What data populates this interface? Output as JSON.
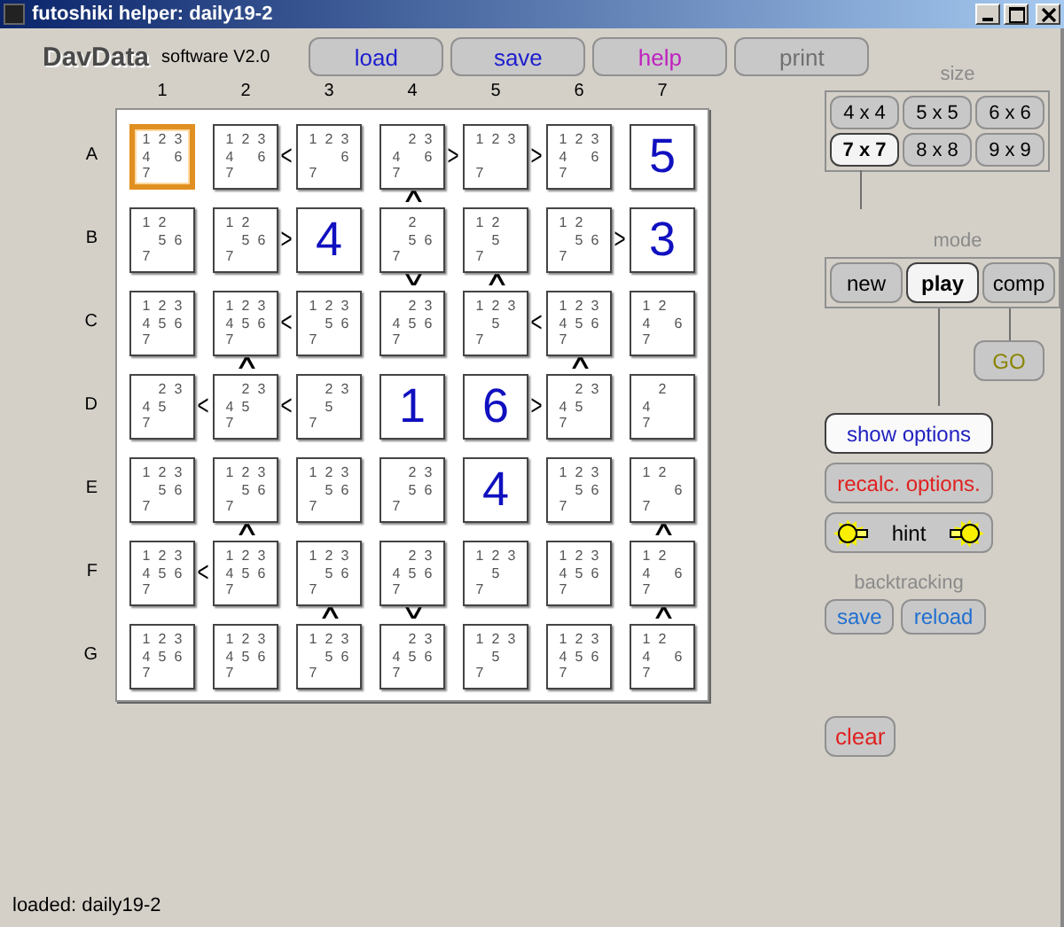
{
  "window": {
    "title": "futoshiki helper: daily19-2"
  },
  "logo": "DavData",
  "version": "software V2.0",
  "toolbar": [
    {
      "label": "load",
      "color": "#1c1cd0",
      "disabled": false
    },
    {
      "label": "save",
      "color": "#1c1cd0",
      "disabled": false
    },
    {
      "label": "help",
      "color": "#c020c0",
      "disabled": false
    },
    {
      "label": "print",
      "disabled": true
    }
  ],
  "board": {
    "column_labels": [
      "1",
      "2",
      "3",
      "4",
      "5",
      "6",
      "7"
    ],
    "row_labels": [
      "A",
      "B",
      "C",
      "D",
      "E",
      "F",
      "G"
    ],
    "rows": [
      [
        {
          "selected": true,
          "candidates": [
            "1",
            "2",
            "3",
            "4",
            "6",
            "7"
          ]
        },
        {
          "selected": false,
          "candidates": [
            "1",
            "2",
            "3",
            "4",
            "6",
            "7"
          ],
          "right": "<"
        },
        {
          "selected": false,
          "candidates": [
            "1",
            "2",
            "3",
            "6",
            "7"
          ]
        },
        {
          "selected": false,
          "candidates": [
            "2",
            "3",
            "4",
            "6",
            "7"
          ],
          "right": ">",
          "below": "∧"
        },
        {
          "selected": false,
          "candidates": [
            "1",
            "2",
            "3",
            "7"
          ],
          "right": ">"
        },
        {
          "selected": false,
          "candidates": [
            "1",
            "2",
            "3",
            "4",
            "6",
            "7"
          ]
        },
        {
          "selected": false,
          "value": "5"
        }
      ],
      [
        {
          "selected": false,
          "candidates": [
            "1",
            "2",
            "5",
            "6",
            "7"
          ]
        },
        {
          "selected": false,
          "candidates": [
            "1",
            "2",
            "5",
            "6",
            "7"
          ],
          "right": ">"
        },
        {
          "selected": false,
          "value": "4"
        },
        {
          "selected": false,
          "candidates": [
            "2",
            "5",
            "6",
            "7"
          ],
          "below": "∨"
        },
        {
          "selected": false,
          "candidates": [
            "1",
            "2",
            "5",
            "7"
          ],
          "below": "∧"
        },
        {
          "selected": false,
          "candidates": [
            "1",
            "2",
            "5",
            "6",
            "7"
          ],
          "right": ">"
        },
        {
          "selected": false,
          "value": "3"
        }
      ],
      [
        {
          "selected": false,
          "candidates": [
            "1",
            "2",
            "3",
            "4",
            "5",
            "6",
            "7"
          ]
        },
        {
          "selected": false,
          "candidates": [
            "1",
            "2",
            "3",
            "4",
            "5",
            "6",
            "7"
          ],
          "right": "<",
          "below": "∧"
        },
        {
          "selected": false,
          "candidates": [
            "1",
            "2",
            "3",
            "5",
            "6",
            "7"
          ]
        },
        {
          "selected": false,
          "candidates": [
            "2",
            "3",
            "4",
            "5",
            "6",
            "7"
          ]
        },
        {
          "selected": false,
          "candidates": [
            "1",
            "2",
            "3",
            "5",
            "7"
          ],
          "right": "<"
        },
        {
          "selected": false,
          "candidates": [
            "1",
            "2",
            "3",
            "4",
            "5",
            "6",
            "7"
          ],
          "below": "∧"
        },
        {
          "selected": false,
          "candidates": [
            "1",
            "2",
            "4",
            "6",
            "7"
          ]
        }
      ],
      [
        {
          "selected": false,
          "candidates": [
            "2",
            "3",
            "4",
            "5",
            "7"
          ],
          "right": "<"
        },
        {
          "selected": false,
          "candidates": [
            "2",
            "3",
            "4",
            "5",
            "7"
          ],
          "right": "<"
        },
        {
          "selected": false,
          "candidates": [
            "2",
            "3",
            "5",
            "7"
          ]
        },
        {
          "selected": false,
          "value": "1"
        },
        {
          "selected": false,
          "value": "6",
          "right": ">"
        },
        {
          "selected": false,
          "candidates": [
            "2",
            "3",
            "4",
            "5",
            "7"
          ]
        },
        {
          "selected": false,
          "candidates": [
            "2",
            "4",
            "7"
          ]
        }
      ],
      [
        {
          "selected": false,
          "candidates": [
            "1",
            "2",
            "3",
            "5",
            "6",
            "7"
          ]
        },
        {
          "selected": false,
          "candidates": [
            "1",
            "2",
            "3",
            "5",
            "6",
            "7"
          ],
          "below": "∧"
        },
        {
          "selected": false,
          "candidates": [
            "1",
            "2",
            "3",
            "5",
            "6",
            "7"
          ]
        },
        {
          "selected": false,
          "candidates": [
            "2",
            "3",
            "5",
            "6",
            "7"
          ]
        },
        {
          "selected": false,
          "value": "4"
        },
        {
          "selected": false,
          "candidates": [
            "1",
            "2",
            "3",
            "5",
            "6",
            "7"
          ]
        },
        {
          "selected": false,
          "candidates": [
            "1",
            "2",
            "6",
            "7"
          ],
          "below": "∧"
        }
      ],
      [
        {
          "selected": false,
          "candidates": [
            "1",
            "2",
            "3",
            "4",
            "5",
            "6",
            "7"
          ],
          "right": "<"
        },
        {
          "selected": false,
          "candidates": [
            "1",
            "2",
            "3",
            "4",
            "5",
            "6",
            "7"
          ]
        },
        {
          "selected": false,
          "candidates": [
            "1",
            "2",
            "3",
            "5",
            "6",
            "7"
          ],
          "below": "∧"
        },
        {
          "selected": false,
          "candidates": [
            "2",
            "3",
            "4",
            "5",
            "6",
            "7"
          ],
          "below": "∨"
        },
        {
          "selected": false,
          "candidates": [
            "1",
            "2",
            "3",
            "5",
            "7"
          ]
        },
        {
          "selected": false,
          "candidates": [
            "1",
            "2",
            "3",
            "4",
            "5",
            "6",
            "7"
          ]
        },
        {
          "selected": false,
          "candidates": [
            "1",
            "2",
            "4",
            "6",
            "7"
          ],
          "below": "∧"
        }
      ],
      [
        {
          "selected": false,
          "candidates": [
            "1",
            "2",
            "3",
            "4",
            "5",
            "6",
            "7"
          ]
        },
        {
          "selected": false,
          "candidates": [
            "1",
            "2",
            "3",
            "4",
            "5",
            "6",
            "7"
          ]
        },
        {
          "selected": false,
          "candidates": [
            "1",
            "2",
            "3",
            "5",
            "6",
            "7"
          ]
        },
        {
          "selected": false,
          "candidates": [
            "2",
            "3",
            "4",
            "5",
            "6",
            "7"
          ]
        },
        {
          "selected": false,
          "candidates": [
            "1",
            "2",
            "3",
            "5",
            "7"
          ]
        },
        {
          "selected": false,
          "candidates": [
            "1",
            "2",
            "3",
            "4",
            "5",
            "6",
            "7"
          ]
        },
        {
          "selected": false,
          "candidates": [
            "1",
            "2",
            "4",
            "6",
            "7"
          ]
        }
      ]
    ]
  },
  "size": {
    "label": "size",
    "options": [
      {
        "label": "4 x 4",
        "selected": false
      },
      {
        "label": "5 x 5",
        "selected": false
      },
      {
        "label": "6 x 6",
        "selected": false
      },
      {
        "label": "7 x 7",
        "selected": true
      },
      {
        "label": "8 x 8",
        "selected": false
      },
      {
        "label": "9 x 9",
        "selected": false
      }
    ]
  },
  "mode": {
    "label": "mode",
    "options": [
      {
        "label": "new",
        "selected": false
      },
      {
        "label": "play",
        "selected": true
      },
      {
        "label": "comp",
        "selected": false
      }
    ]
  },
  "go": {
    "label": "GO",
    "disabled": true
  },
  "show_options": {
    "label": "show options",
    "on": true
  },
  "recalc": {
    "label": "recalc. options."
  },
  "hint": {
    "label": "hint"
  },
  "backtracking": {
    "label": "backtracking",
    "buttons": [
      "save",
      "reload"
    ]
  },
  "clear": {
    "label": "clear"
  },
  "status": "loaded: daily19-2"
}
